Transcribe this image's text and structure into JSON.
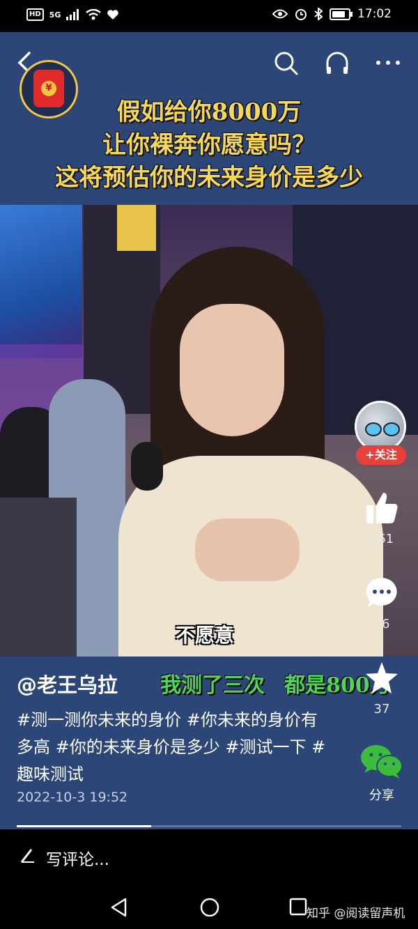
{
  "status_bar": {
    "hd": "HD",
    "signal": "5G",
    "time": "17:02"
  },
  "video": {
    "headline_lines": [
      "假如给你8000万",
      "让你裸奔你愿意吗？",
      "这将预估你的未来身价是多少"
    ],
    "subtitle": "不愿意",
    "caption_overlay": [
      "我测了三次",
      "都是800万"
    ],
    "red_packet_symbol": "¥"
  },
  "post": {
    "author": "@老王乌拉",
    "description": "#测一测你未来的身价 #你未来的身价有多高 #你的未来身价是多少 #测试一下 #趣味测试",
    "date": "2022-10-3 19:52",
    "progress": 0.35
  },
  "rail": {
    "follow_label": "+关注",
    "like_count": "861",
    "comment_count": "96",
    "favorite_count": "37",
    "share_label": "分享"
  },
  "comment_bar": {
    "placeholder": "写评论..."
  },
  "watermark": "知乎 @阅读留声机",
  "icons": {
    "back": "back-arrow-icon",
    "search": "search-icon",
    "headphones": "headphones-icon",
    "more": "more-icon",
    "like": "thumbs-up-icon",
    "comment": "comment-icon",
    "favorite": "star-icon",
    "share": "wechat-icon"
  }
}
